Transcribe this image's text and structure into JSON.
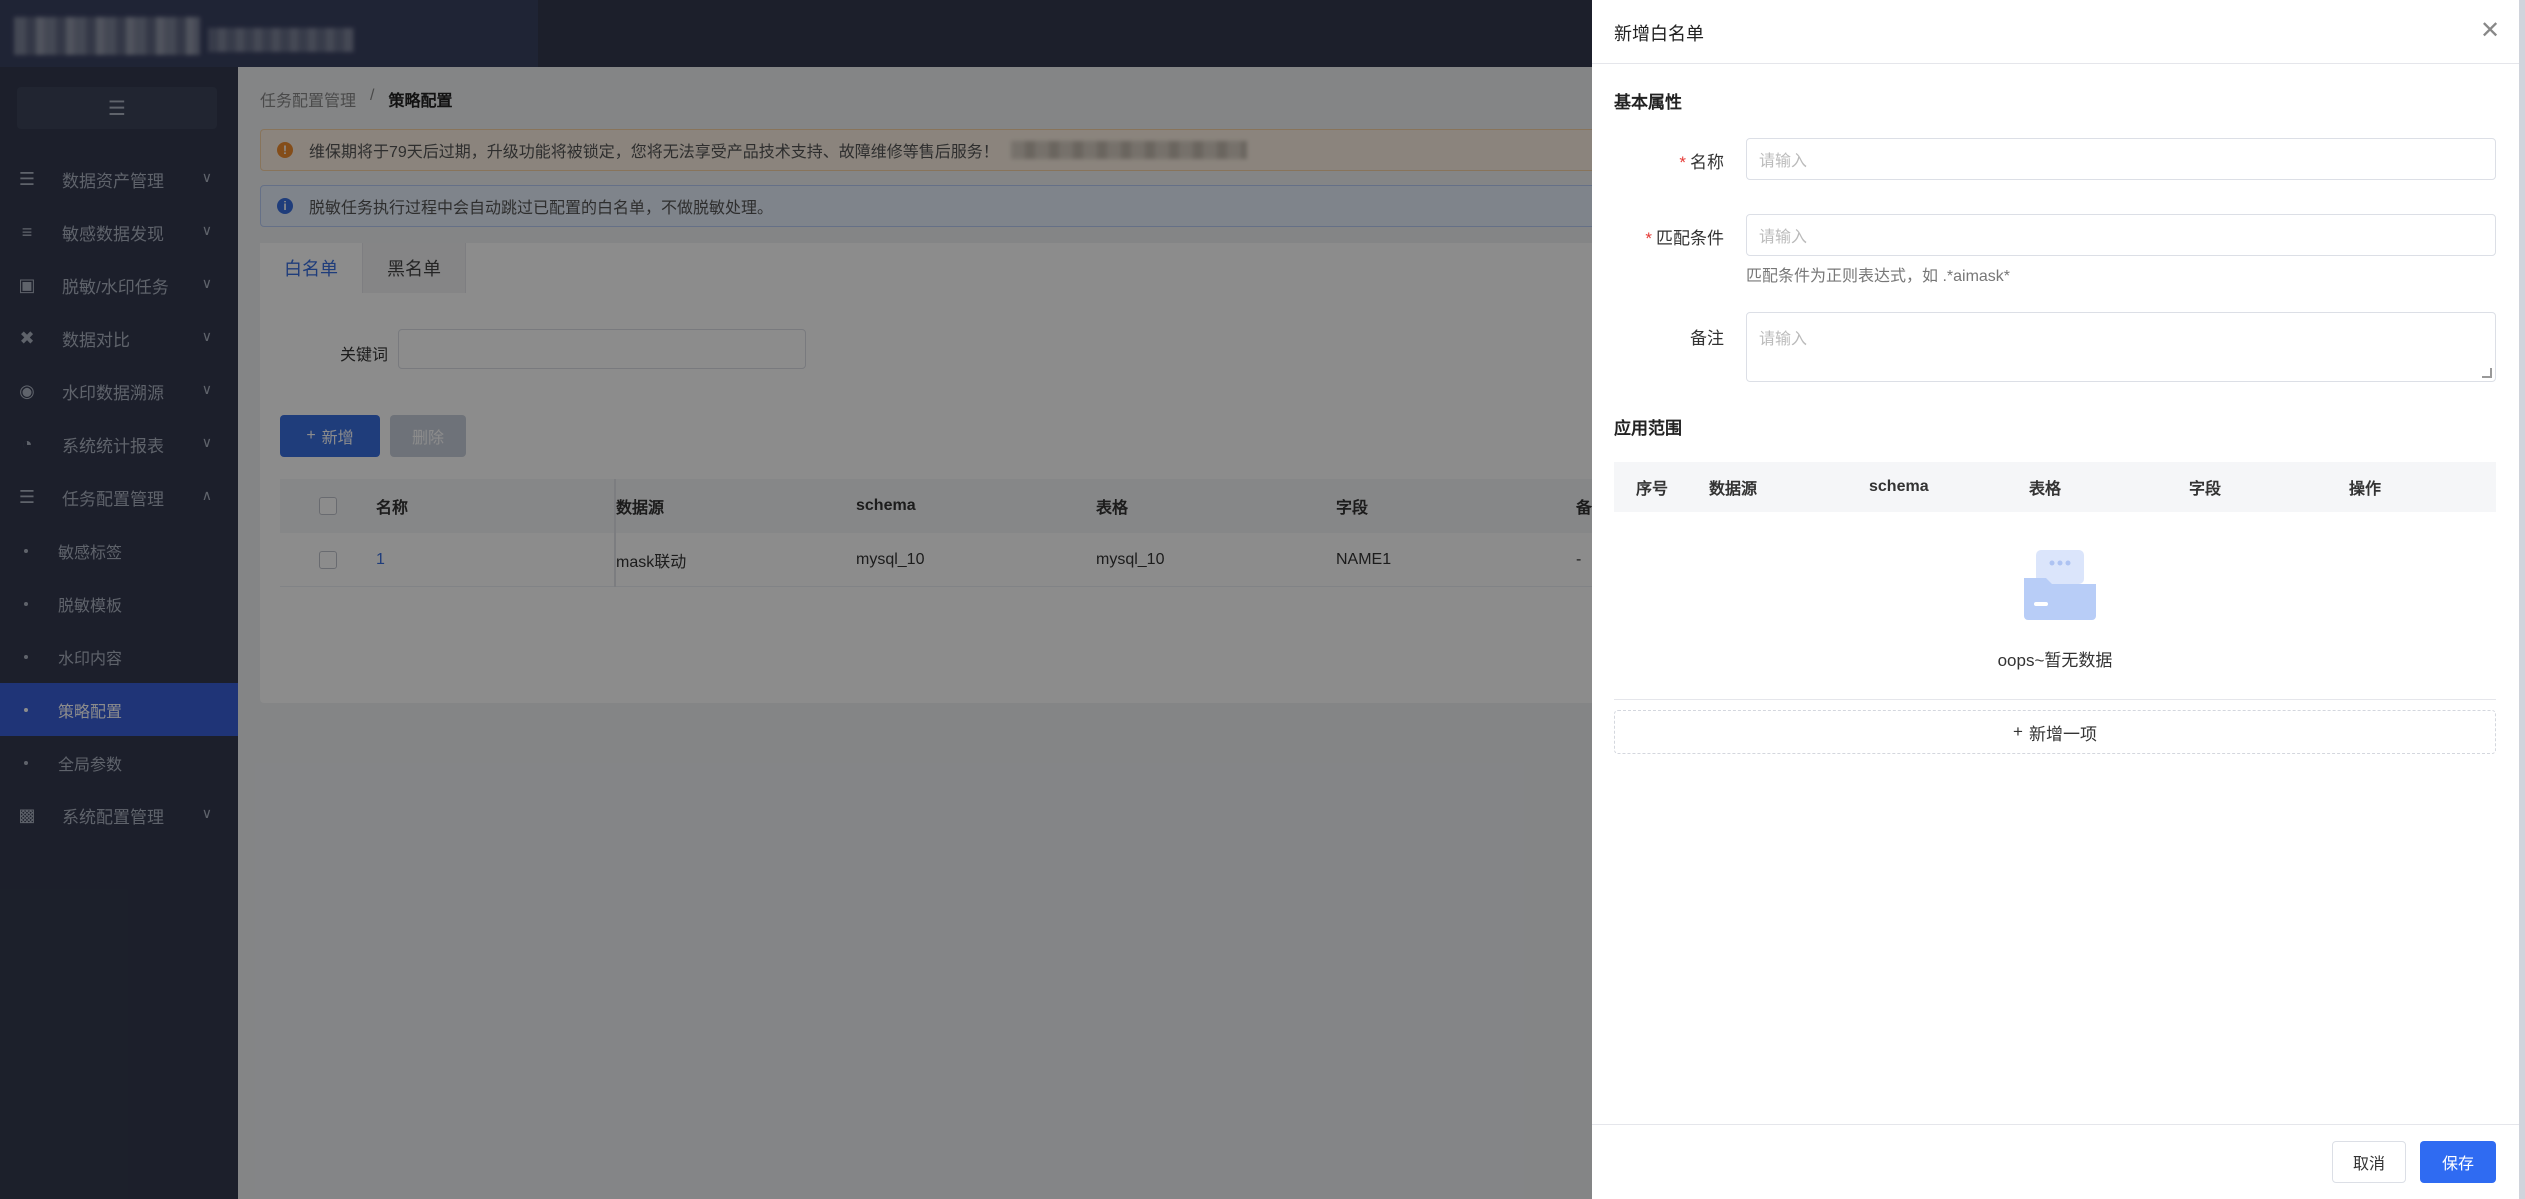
{
  "header": {
    "logo_alt": ""
  },
  "sidebar": {
    "collapse_icon": "menu-fold-icon",
    "items": [
      {
        "label": "数据资产管理",
        "icon": "layers-icon"
      },
      {
        "label": "敏感数据发现",
        "icon": "list-search-icon"
      },
      {
        "label": "脱敏/水印任务",
        "icon": "text-box-icon"
      },
      {
        "label": "数据对比",
        "icon": "compare-icon"
      },
      {
        "label": "水印数据溯源",
        "icon": "target-icon"
      },
      {
        "label": "系统统计报表",
        "icon": "pie-chart-icon"
      },
      {
        "label": "任务配置管理",
        "icon": "task-list-icon"
      }
    ],
    "sub_items": [
      {
        "label": "敏感标签"
      },
      {
        "label": "脱敏模板"
      },
      {
        "label": "水印内容"
      },
      {
        "label": "策略配置"
      },
      {
        "label": "全局参数"
      }
    ],
    "last_item": {
      "label": "系统配置管理",
      "icon": "settings-panel-icon"
    }
  },
  "breadcrumb": {
    "parent": "任务配置管理",
    "separator": "/",
    "current": "策略配置"
  },
  "alerts": {
    "warning": "维保期将于79天后过期，升级功能将被锁定，您将无法享受产品技术支持、故障维修等售后服务！",
    "info": "脱敏任务执行过程中会自动跳过已配置的白名单，不做脱敏处理。"
  },
  "tabs": [
    {
      "label": "白名单"
    },
    {
      "label": "黑名单"
    }
  ],
  "filter": {
    "keyword_label": "关键词"
  },
  "toolbar": {
    "add_label": "新增",
    "delete_label": "删除"
  },
  "table": {
    "columns": [
      "名称",
      "数据源",
      "schema",
      "表格",
      "字段",
      "备注"
    ],
    "rows": [
      {
        "name": "1",
        "datasource": "mask联动",
        "schema": "mysql_10",
        "table": "mysql_10",
        "field": "NAME1",
        "remark": "-"
      }
    ]
  },
  "drawer": {
    "title": "新增白名单",
    "section_basic": "基本属性",
    "name_label": "名称",
    "name_placeholder": "请输入",
    "match_label": "匹配条件",
    "match_placeholder": "请输入",
    "match_hint": "匹配条件为正则表达式，如 .*aimask*",
    "remark_label": "备注",
    "remark_placeholder": "请输入",
    "section_scope": "应用范围",
    "scope_columns": [
      "序号",
      "数据源",
      "schema",
      "表格",
      "字段",
      "操作"
    ],
    "empty_text": "oops~暂无数据",
    "add_row_label": "新增一项",
    "cancel_label": "取消",
    "save_label": "保存"
  },
  "colors": {
    "primary": "#2f6bf2",
    "sidebar_bg": "#333a4f",
    "active_menu": "#3a5fd9",
    "required": "#e53935"
  }
}
